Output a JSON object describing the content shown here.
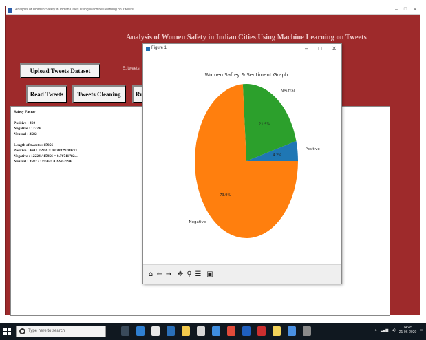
{
  "app": {
    "title": "Analysis of Women Safety in Indian Cities Using Machine Learning on Tweets",
    "heading": "Analysis of Women Safety in Indian Cities Using Machine Learning on Tweets",
    "status_text": "E:/tweets",
    "window_controls": {
      "minimize": "–",
      "maximize": "□",
      "close": "✕"
    }
  },
  "buttons": {
    "upload": "Upload Tweets Dataset",
    "read": "Read Tweets",
    "clean": "Tweets Cleaning",
    "run": "Run"
  },
  "output": {
    "lines": [
      "Safety Factor",
      "",
      "Positive : 460",
      "Negative : 12224",
      "Neutral : 3582",
      "",
      "Length of tweets : 15956",
      "Positive : 460 / 15956 = 0.028829280771...",
      "Negative : 12224 / 15956 = 0.76711782...",
      "Neutral : 3582 / 15956 = 0.22453994..."
    ]
  },
  "figure": {
    "window_title": "Figure 1",
    "window_controls": {
      "minimize": "–",
      "maximize": "□",
      "close": "✕"
    },
    "toolbar": [
      "home-icon",
      "back-icon",
      "forward-icon",
      "pan-icon",
      "zoom-icon",
      "configure-icon",
      "save-icon"
    ]
  },
  "chart_data": {
    "type": "pie",
    "title": "Women Saftey & Sentiment Graph",
    "labels": [
      "Positive",
      "Neutral",
      "Negative"
    ],
    "values": [
      4.2,
      21.9,
      73.9
    ],
    "value_labels": [
      "4.2%",
      "21.9%",
      "73.9%"
    ],
    "colors": [
      "#1f77b4",
      "#2ca02c",
      "#ff7f0e"
    ]
  },
  "taskbar": {
    "search_placeholder": "Type here to search",
    "time": "14:45",
    "date": "21-06-2020"
  }
}
